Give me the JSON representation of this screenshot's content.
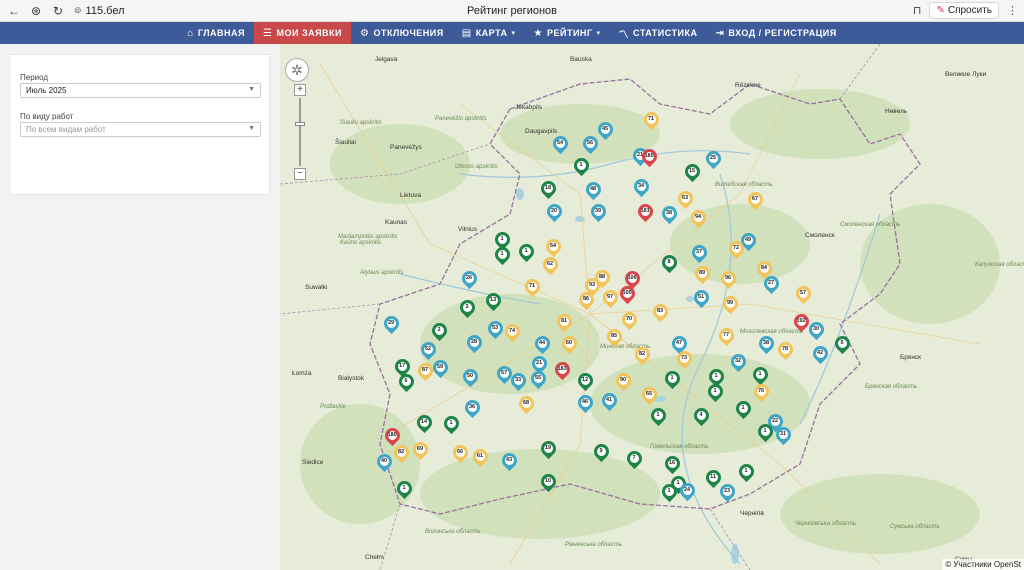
{
  "browser": {
    "url": "115.бел",
    "tab_title": "Рейтинг регионов",
    "ask_label": "Спросить"
  },
  "nav": {
    "items": [
      {
        "label": "ГЛАВНАЯ",
        "icon": "home-icon",
        "glyph": "⌂",
        "active": false
      },
      {
        "label": "МОИ ЗАЯВКИ",
        "icon": "list-icon",
        "glyph": "☰",
        "active": true
      },
      {
        "label": "ОТКЛЮЧЕНИЯ",
        "icon": "gear-icon",
        "glyph": "⚙",
        "active": false
      },
      {
        "label": "КАРТА",
        "icon": "map-icon",
        "glyph": "▤",
        "active": false,
        "caret": "▾"
      },
      {
        "label": "РЕЙТИНГ",
        "icon": "star-icon",
        "glyph": "★",
        "active": false,
        "caret": "▾"
      },
      {
        "label": "СТАТИСТИКА",
        "icon": "chart-icon",
        "glyph": "〽",
        "active": false
      },
      {
        "label": "ВХОД / РЕГИСТРАЦИЯ",
        "icon": "login-icon",
        "glyph": "⇥",
        "active": false
      }
    ]
  },
  "filters": {
    "period_label": "Период",
    "period_value": "Июль 2025",
    "worktype_label": "По виду работ",
    "worktype_placeholder": "По всем видам работ"
  },
  "map": {
    "attribution": "© Участники OpenSt",
    "colors": {
      "green": "#1e8449",
      "blue": "#3fa6c8",
      "yellow": "#f2c45a",
      "red": "#d9464e"
    },
    "labels": [
      {
        "t": "Jelgava",
        "c": "city"
      },
      {
        "t": "Bauska",
        "c": "city"
      },
      {
        "t": "Rēzekne",
        "c": "city"
      },
      {
        "t": "Jēkabpils",
        "c": "city"
      },
      {
        "t": "Daugavpils",
        "c": "city"
      },
      {
        "t": "Šiauliai",
        "c": "city"
      },
      {
        "t": "Panevėžys",
        "c": "city"
      },
      {
        "t": "Lietuva",
        "c": "city"
      },
      {
        "t": "Kaunas",
        "c": "city"
      },
      {
        "t": "Vilnius",
        "c": "city"
      },
      {
        "t": "Suwałki",
        "c": "city"
      },
      {
        "t": "Białystok",
        "c": "city"
      },
      {
        "t": "Łomża",
        "c": "city"
      },
      {
        "t": "Siedlce",
        "c": "city"
      },
      {
        "t": "Chełm",
        "c": "city"
      },
      {
        "t": "Смоленск",
        "c": "city"
      },
      {
        "t": "Брянск",
        "c": "city"
      },
      {
        "t": "Чернігів",
        "c": "city"
      },
      {
        "t": "Великие Луки",
        "c": "city"
      },
      {
        "t": "Невель",
        "c": "city"
      },
      {
        "t": "Сумы",
        "c": "city"
      },
      {
        "t": "Siauliu apskritis",
        "c": "green"
      },
      {
        "t": "Panevėžio apskritis",
        "c": "green"
      },
      {
        "t": "Utenos apskritis",
        "c": "green"
      },
      {
        "t": "Kauno apskritis",
        "c": "green"
      },
      {
        "t": "Marijampolės apskritis",
        "c": "green"
      },
      {
        "t": "Alytaus apskritis",
        "c": "green"
      },
      {
        "t": "Смоленская область",
        "c": "green"
      },
      {
        "t": "Калужская область",
        "c": "green"
      },
      {
        "t": "Брянская область",
        "c": "green"
      },
      {
        "t": "Гомельская область",
        "c": "green"
      },
      {
        "t": "Могилевская область",
        "c": "green"
      },
      {
        "t": "Витебская область",
        "c": "green"
      },
      {
        "t": "Минская область",
        "c": "green"
      },
      {
        "t": "Волинська область",
        "c": "green"
      },
      {
        "t": "Рівненська область",
        "c": "green"
      },
      {
        "t": "Чернігівська область",
        "c": "green"
      },
      {
        "t": "Сумська область",
        "c": "green"
      },
      {
        "t": "Podlaskie",
        "c": "green"
      }
    ],
    "markers": [
      {
        "n": "71",
        "color": "yellow"
      },
      {
        "n": "45",
        "color": "blue"
      },
      {
        "n": "54",
        "color": "blue"
      },
      {
        "n": "56",
        "color": "blue"
      },
      {
        "n": "1",
        "color": "green"
      },
      {
        "n": "21",
        "color": "blue"
      },
      {
        "n": "185",
        "color": "red"
      },
      {
        "n": "15",
        "color": "green"
      },
      {
        "n": "25",
        "color": "blue"
      },
      {
        "n": "18",
        "color": "green"
      },
      {
        "n": "48",
        "color": "blue"
      },
      {
        "n": "34",
        "color": "blue"
      },
      {
        "n": "20",
        "color": "blue"
      },
      {
        "n": "39",
        "color": "blue"
      },
      {
        "n": "181",
        "color": "red"
      },
      {
        "n": "38",
        "color": "blue"
      },
      {
        "n": "63",
        "color": "yellow"
      },
      {
        "n": "94",
        "color": "yellow"
      },
      {
        "n": "67",
        "color": "yellow"
      },
      {
        "n": "1",
        "color": "green"
      },
      {
        "n": "1",
        "color": "green"
      },
      {
        "n": "1",
        "color": "green"
      },
      {
        "n": "64",
        "color": "yellow"
      },
      {
        "n": "62",
        "color": "yellow"
      },
      {
        "n": "49",
        "color": "blue"
      },
      {
        "n": "72",
        "color": "yellow"
      },
      {
        "n": "37",
        "color": "blue"
      },
      {
        "n": "8",
        "color": "green"
      },
      {
        "n": "26",
        "color": "blue"
      },
      {
        "n": "71",
        "color": "yellow"
      },
      {
        "n": "93",
        "color": "yellow"
      },
      {
        "n": "88",
        "color": "yellow"
      },
      {
        "n": "106",
        "color": "red"
      },
      {
        "n": "105",
        "color": "red"
      },
      {
        "n": "89",
        "color": "yellow"
      },
      {
        "n": "96",
        "color": "yellow"
      },
      {
        "n": "84",
        "color": "yellow"
      },
      {
        "n": "27",
        "color": "blue"
      },
      {
        "n": "3",
        "color": "green"
      },
      {
        "n": "13",
        "color": "green"
      },
      {
        "n": "86",
        "color": "yellow"
      },
      {
        "n": "97",
        "color": "yellow"
      },
      {
        "n": "51",
        "color": "blue"
      },
      {
        "n": "99",
        "color": "yellow"
      },
      {
        "n": "57",
        "color": "yellow"
      },
      {
        "n": "29",
        "color": "blue"
      },
      {
        "n": "2",
        "color": "green"
      },
      {
        "n": "53",
        "color": "blue"
      },
      {
        "n": "74",
        "color": "yellow"
      },
      {
        "n": "81",
        "color": "yellow"
      },
      {
        "n": "70",
        "color": "yellow"
      },
      {
        "n": "83",
        "color": "yellow"
      },
      {
        "n": "192",
        "color": "red"
      },
      {
        "n": "30",
        "color": "blue"
      },
      {
        "n": "52",
        "color": "blue"
      },
      {
        "n": "28",
        "color": "blue"
      },
      {
        "n": "44",
        "color": "blue"
      },
      {
        "n": "60",
        "color": "yellow"
      },
      {
        "n": "85",
        "color": "yellow"
      },
      {
        "n": "47",
        "color": "blue"
      },
      {
        "n": "77",
        "color": "yellow"
      },
      {
        "n": "38",
        "color": "blue"
      },
      {
        "n": "78",
        "color": "yellow"
      },
      {
        "n": "42",
        "color": "blue"
      },
      {
        "n": "5",
        "color": "green"
      },
      {
        "n": "17",
        "color": "green"
      },
      {
        "n": "6",
        "color": "green"
      },
      {
        "n": "87",
        "color": "yellow"
      },
      {
        "n": "59",
        "color": "blue"
      },
      {
        "n": "50",
        "color": "blue"
      },
      {
        "n": "21",
        "color": "blue"
      },
      {
        "n": "183",
        "color": "red"
      },
      {
        "n": "82",
        "color": "yellow"
      },
      {
        "n": "73",
        "color": "yellow"
      },
      {
        "n": "32",
        "color": "blue"
      },
      {
        "n": "57",
        "color": "blue"
      },
      {
        "n": "33",
        "color": "blue"
      },
      {
        "n": "55",
        "color": "blue"
      },
      {
        "n": "12",
        "color": "green"
      },
      {
        "n": "90",
        "color": "yellow"
      },
      {
        "n": "1",
        "color": "green"
      },
      {
        "n": "1",
        "color": "green"
      },
      {
        "n": "1",
        "color": "green"
      },
      {
        "n": "1",
        "color": "green"
      },
      {
        "n": "76",
        "color": "yellow"
      },
      {
        "n": "65",
        "color": "yellow"
      },
      {
        "n": "68",
        "color": "yellow"
      },
      {
        "n": "46",
        "color": "blue"
      },
      {
        "n": "41",
        "color": "blue"
      },
      {
        "n": "36",
        "color": "blue"
      },
      {
        "n": "14",
        "color": "green"
      },
      {
        "n": "1",
        "color": "green"
      },
      {
        "n": "1",
        "color": "green"
      },
      {
        "n": "4",
        "color": "green"
      },
      {
        "n": "1",
        "color": "green"
      },
      {
        "n": "22",
        "color": "blue"
      },
      {
        "n": "1",
        "color": "green"
      },
      {
        "n": "31",
        "color": "blue"
      },
      {
        "n": "180",
        "color": "red"
      },
      {
        "n": "82",
        "color": "yellow"
      },
      {
        "n": "69",
        "color": "yellow"
      },
      {
        "n": "40",
        "color": "blue"
      },
      {
        "n": "66",
        "color": "yellow"
      },
      {
        "n": "61",
        "color": "yellow"
      },
      {
        "n": "43",
        "color": "blue"
      },
      {
        "n": "19",
        "color": "green"
      },
      {
        "n": "9",
        "color": "green"
      },
      {
        "n": "7",
        "color": "green"
      },
      {
        "n": "16",
        "color": "green"
      },
      {
        "n": "1",
        "color": "green"
      },
      {
        "n": "1",
        "color": "green"
      },
      {
        "n": "11",
        "color": "green"
      },
      {
        "n": "10",
        "color": "green"
      },
      {
        "n": "1",
        "color": "green"
      },
      {
        "n": "24",
        "color": "blue"
      },
      {
        "n": "1",
        "color": "green"
      },
      {
        "n": "23",
        "color": "blue"
      }
    ]
  }
}
